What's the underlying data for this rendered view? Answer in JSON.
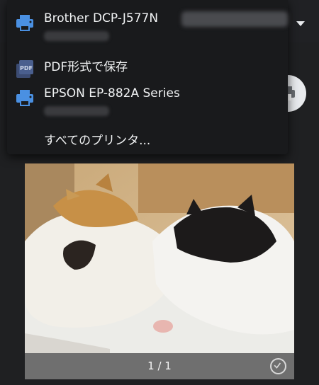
{
  "printers": [
    {
      "name": "Brother DCP-J577N",
      "icon": "printer-icon"
    },
    {
      "name": "PDF形式で保存",
      "icon": "pdf-icon"
    },
    {
      "name": "EPSON EP-882A Series",
      "icon": "printer-icon"
    },
    {
      "name": "すべてのプリンタ...",
      "icon": ""
    }
  ],
  "preview": {
    "page_indicator": "1 / 1",
    "selected": true
  },
  "colors": {
    "printer_icon": "#4a90e2",
    "menu_background": "#191a1c",
    "page_background": "#1f2022"
  }
}
